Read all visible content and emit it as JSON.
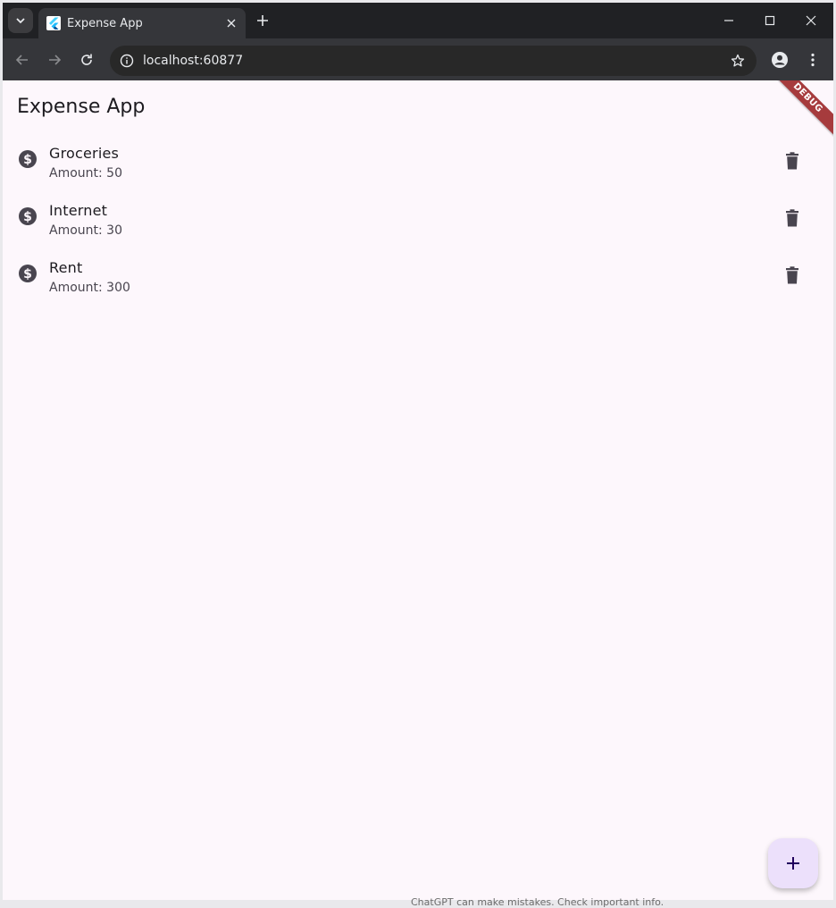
{
  "browser": {
    "tab": {
      "title": "Expense App",
      "favicon": "flutter-icon"
    },
    "omnibox": {
      "url": "localhost:60877"
    },
    "icons": {
      "tab_search": "chevron-down-icon",
      "tab_close": "close-icon",
      "new_tab": "plus-icon",
      "back": "arrow-left-icon",
      "forward": "arrow-right-icon",
      "reload": "reload-icon",
      "site_info": "info-icon",
      "bookmark": "star-icon",
      "profile": "person-icon",
      "menu": "kebab-menu-icon"
    }
  },
  "app": {
    "title": "Expense App",
    "debug_banner": "DEBUG",
    "expenses": [
      {
        "title": "Groceries",
        "subtitle": "Amount: 50"
      },
      {
        "title": "Internet",
        "subtitle": "Amount: 30"
      },
      {
        "title": "Rent",
        "subtitle": "Amount: 300"
      }
    ],
    "item_icon": "dollar-circle-icon",
    "delete_icon": "trash-icon",
    "fab_icon": "plus-icon"
  },
  "background_text": "ChatGPT can make mistakes. Check important info.",
  "colors": {
    "page_background": "#fdf7fc",
    "fab_background": "#ece0fb",
    "debug_banner": "#a63b3d",
    "browser_frame": "#202124"
  }
}
